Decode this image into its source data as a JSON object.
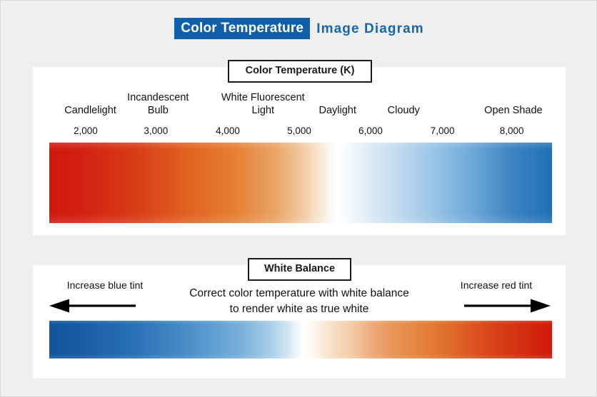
{
  "header": {
    "badge_text": "Color Temperature",
    "rest_text": "Image Diagram",
    "badge_color": "#0f5faa",
    "rest_color": "#1666ae"
  },
  "color_temperature_section": {
    "label": "Color Temperature (K)",
    "sources": [
      {
        "name": "Candlelight",
        "lines": [
          "Candlelight"
        ],
        "x_percent": 10.8
      },
      {
        "name": "Incandescent Bulb",
        "lines": [
          "Incandescent",
          "Bulb"
        ],
        "x_percent": 23.5
      },
      {
        "name": "White Fluorescent Light",
        "lines": [
          "White Fluorescent",
          "Light"
        ],
        "x_percent": 43.2
      },
      {
        "name": "Daylight",
        "lines": [
          "Daylight"
        ],
        "x_percent": 57.2
      },
      {
        "name": "Cloudy",
        "lines": [
          "Cloudy"
        ],
        "x_percent": 69.6
      },
      {
        "name": "Open Shade",
        "lines": [
          "Open Shade"
        ],
        "x_percent": 90.2
      }
    ],
    "kelvin_ticks": [
      {
        "label": "2,000",
        "x_percent": 9.9
      },
      {
        "label": "3,000",
        "x_percent": 23.1
      },
      {
        "label": "4,000",
        "x_percent": 36.6
      },
      {
        "label": "5,000",
        "x_percent": 50.0
      },
      {
        "label": "6,000",
        "x_percent": 63.4
      },
      {
        "label": "7,000",
        "x_percent": 76.9
      },
      {
        "label": "8,000",
        "x_percent": 89.9
      }
    ],
    "gradient": {
      "left_color": "#d0190b",
      "white_point_color": "#ffffff",
      "right_color": "#1f6fb5",
      "white_point_percent": 57.5
    }
  },
  "white_balance_section": {
    "label": "White Balance",
    "left_label": "Increase blue tint",
    "right_label": "Increase red tint",
    "center_lines": [
      "Correct color temperature with white balance",
      "to render white as true white"
    ],
    "left_arrow_direction": "left",
    "right_arrow_direction": "right",
    "gradient": {
      "left_color": "#12559f",
      "white_point_color": "#ffffff",
      "right_color": "#d0180a",
      "white_point_percent": 50.5
    }
  }
}
